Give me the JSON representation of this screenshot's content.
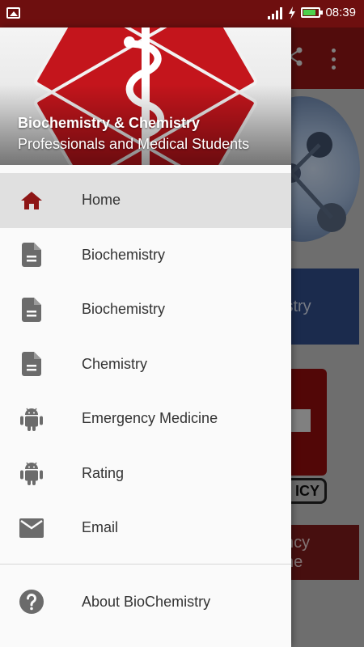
{
  "status_bar": {
    "time": "08:39",
    "icons": [
      "image-icon",
      "signal-icon",
      "charging-icon",
      "battery-icon"
    ],
    "battery_color": "#4cd14c"
  },
  "drawer": {
    "header": {
      "title": "Biochemistry & Chemistry",
      "subtitle": "Professionals and Medical Students"
    },
    "items": [
      {
        "label": "Home",
        "icon": "home-icon",
        "active": true
      },
      {
        "label": "Biochemistry",
        "icon": "document-icon"
      },
      {
        "label": "Biochemistry",
        "icon": "document-icon"
      },
      {
        "label": "Chemistry",
        "icon": "document-icon"
      },
      {
        "label": "Emergency Medicine",
        "icon": "android-icon"
      },
      {
        "label": "Rating",
        "icon": "android-icon"
      },
      {
        "label": "Email",
        "icon": "email-icon"
      }
    ],
    "footer_item": {
      "label": "About BioChemistry",
      "icon": "help-icon"
    }
  },
  "background": {
    "card1_text": "istry",
    "card2_badge": "ICY",
    "card3_text_line1": "ncy",
    "card3_text_line2": "ne"
  },
  "colors": {
    "status_bar": "#6e0f0f",
    "toolbar": "#8e1616",
    "accent_red": "#b71c1c",
    "active_item_bg": "#e0e0e0"
  }
}
